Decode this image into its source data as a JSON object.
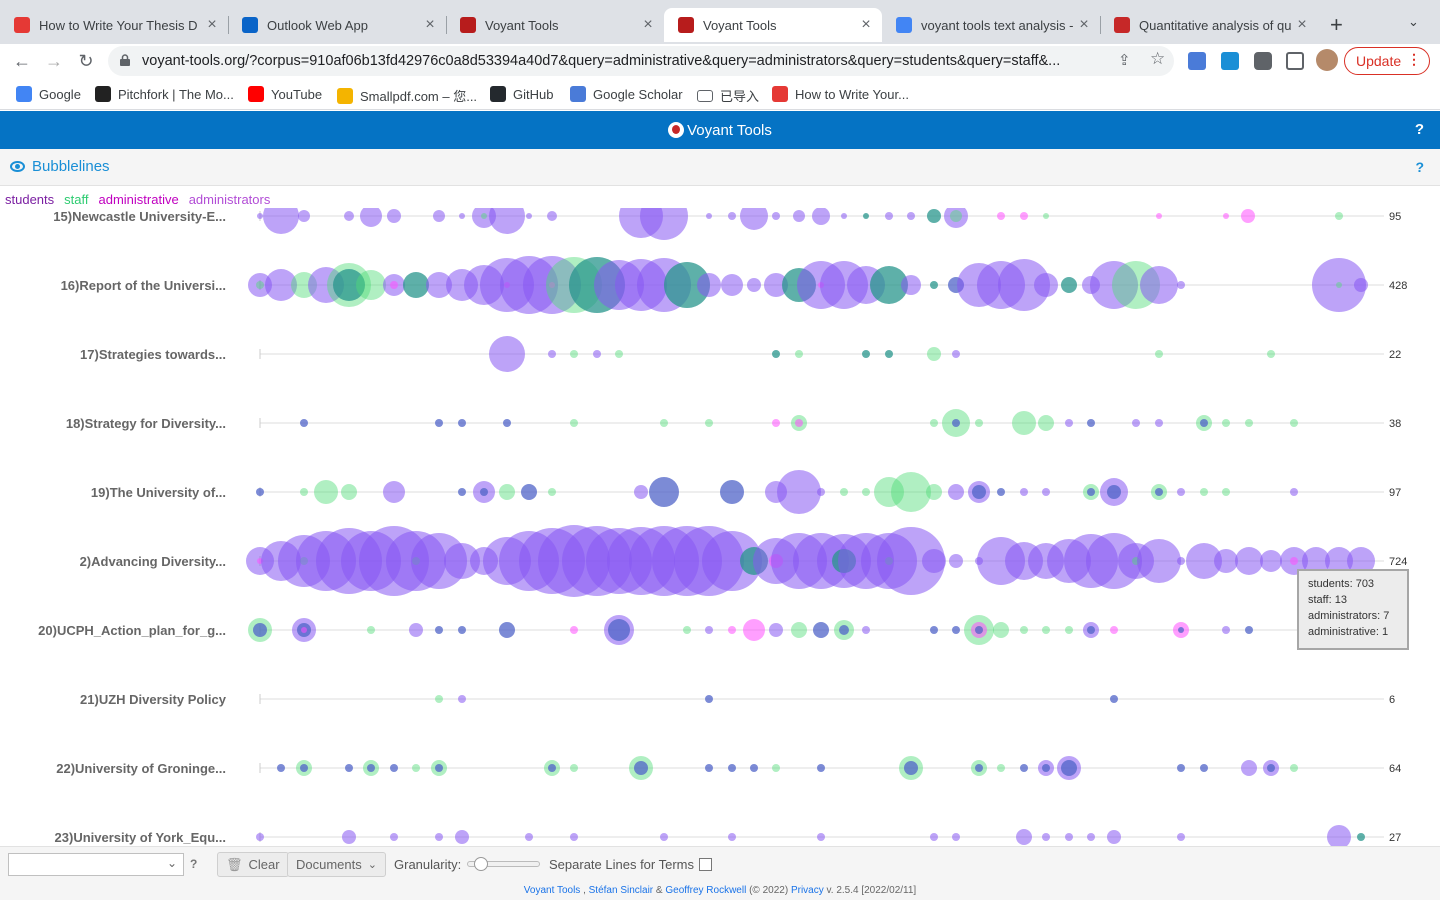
{
  "browser": {
    "tabs": [
      {
        "title": "How to Write Your Thesis D",
        "icon": "scribbr-icon",
        "color": "#e53935",
        "active": false
      },
      {
        "title": "Outlook Web App",
        "icon": "outlook-icon",
        "color": "#0a64c8",
        "active": false
      },
      {
        "title": "Voyant Tools",
        "icon": "voyant-icon",
        "color": "#b71c1c",
        "active": false
      },
      {
        "title": "Voyant Tools",
        "icon": "voyant-icon",
        "color": "#b71c1c",
        "active": true
      },
      {
        "title": "voyant tools text analysis -",
        "icon": "google-icon",
        "color": "#4285f4",
        "active": false
      },
      {
        "title": "Quantitative analysis of qu",
        "icon": "document-icon",
        "color": "#c62828",
        "active": false
      }
    ],
    "url": "voyant-tools.org/?corpus=910af06b13fd42976c0a8d53394a40d7&query=administrative&query=administrators&query=students&query=staff&...",
    "update_label": "Update",
    "bookmarks": [
      {
        "label": "Google",
        "icon": "google-icon"
      },
      {
        "label": "Pitchfork | The Mo...",
        "icon": "pitchfork-icon"
      },
      {
        "label": "YouTube",
        "icon": "youtube-icon"
      },
      {
        "label": "Smallpdf.com – 您...",
        "icon": "smallpdf-icon"
      },
      {
        "label": "GitHub",
        "icon": "github-icon"
      },
      {
        "label": "Google Scholar",
        "icon": "scholar-icon"
      },
      {
        "label": "已导入",
        "icon": "folder-icon"
      },
      {
        "label": "How to Write Your...",
        "icon": "scribbr-icon"
      }
    ]
  },
  "app": {
    "title": "Voyant Tools",
    "help": "?",
    "panel_title": "Bubblelines",
    "panel_help": "?"
  },
  "legend": [
    {
      "term": "students",
      "color": "#6a1b9a"
    },
    {
      "term": "staff",
      "color": "#2ecc71"
    },
    {
      "term": "administrative",
      "color": "#d400d4"
    },
    {
      "term": "administrators",
      "color": "#a64ddb"
    }
  ],
  "documents": [
    {
      "label": "15)Newcastle University-E...",
      "total": "95"
    },
    {
      "label": "16)Report of the Universi...",
      "total": "428"
    },
    {
      "label": "17)Strategies towards...",
      "total": "22"
    },
    {
      "label": "18)Strategy for Diversity...",
      "total": "38"
    },
    {
      "label": "19)The University of...",
      "total": "97"
    },
    {
      "label": "2)Advancing Diversity...",
      "total": "724"
    },
    {
      "label": "20)UCPH_Action_plan_for_g...",
      "total": ""
    },
    {
      "label": "21)UZH Diversity Policy",
      "total": "6"
    },
    {
      "label": "22)University of Groninge...",
      "total": "64"
    },
    {
      "label": "23)University of York_Equ...",
      "total": "27"
    }
  ],
  "tooltip": {
    "lines": [
      "students: 703",
      "staff: 13",
      "administrators: 7",
      "administrative: 1"
    ]
  },
  "bottom": {
    "clear_label": "Clear",
    "documents_label": "Documents",
    "granularity_label": "Granularity:",
    "separate_lines_label": "Separate Lines for Terms",
    "help": "?"
  },
  "footer": {
    "voyant": "Voyant Tools",
    "sep1": " , ",
    "author1": "Stéfan Sinclair",
    "amp": " & ",
    "author2": "Geoffrey Rockwell",
    "copy": " (© 2022) ",
    "privacy": "Privacy",
    "version": " v. 2.5.4 [2022/02/11]"
  }
}
